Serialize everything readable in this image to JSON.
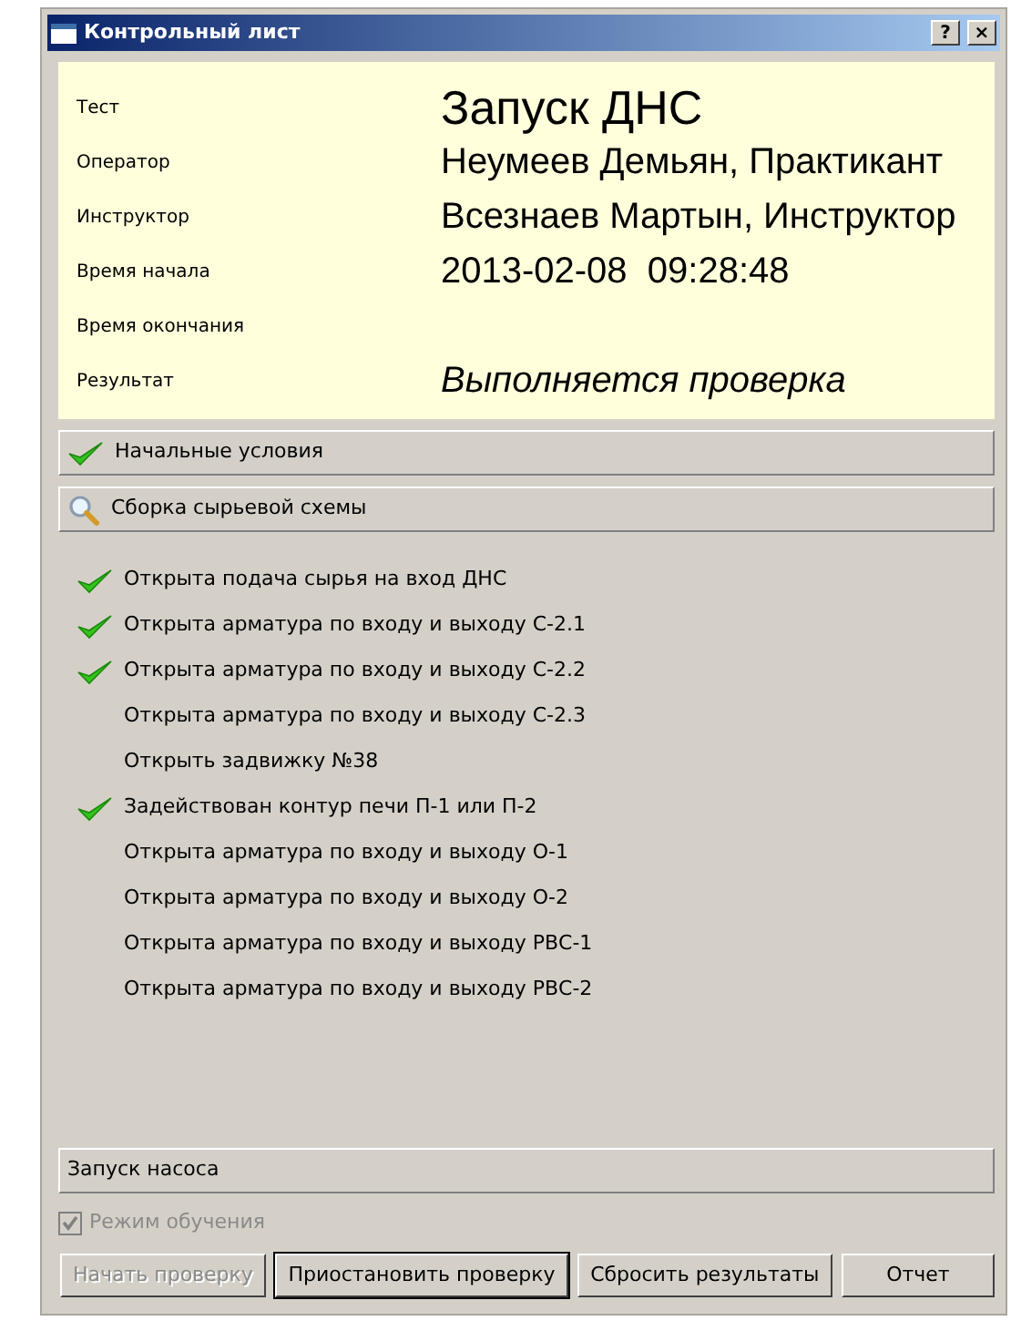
{
  "window": {
    "title": "Контрольный лист",
    "help_button": "?",
    "close_button": "×"
  },
  "info": [
    {
      "label": "Тест",
      "value": "Запуск ДНС",
      "kind": "large"
    },
    {
      "label": "Оператор",
      "value": "Неумеев Демьян, Практикант",
      "kind": "bold"
    },
    {
      "label": "Инструктор",
      "value": "Всезнаев Мартын, Инструктор",
      "kind": "bold"
    },
    {
      "label": "Время начала",
      "value": "2013-02-08  09:28:48",
      "kind": "bold"
    },
    {
      "label": "Время окончания"
    },
    {
      "label": "Результат",
      "value": "Выполняется проверка",
      "kind": "italic"
    }
  ],
  "sections": [
    {
      "title": "Начальные условия",
      "kind": "done"
    },
    {
      "title": "Сборка сырьевой схемы",
      "kind": "active",
      "items": [
        {
          "text": "Открыта подача сырья на вход ДНС",
          "done": true
        },
        {
          "text": "Открыта арматура по входу и выходу С-2.1",
          "done": true
        },
        {
          "text": "Открыта арматура по входу и выходу С-2.2",
          "done": true
        },
        {
          "text": "Открыта арматура по входу и выходу С-2.3",
          "done": false
        },
        {
          "text": "Открыть задвижку №38",
          "done": false
        },
        {
          "text": "Задействован контур печи П-1 или П-2",
          "done": true
        },
        {
          "text": "Открыта арматура по входу и выходу О-1",
          "done": false
        },
        {
          "text": "Открыта арматура по входу и выходу О-2",
          "done": false
        },
        {
          "text": "Открыта арматура по входу и выходу РВС-1",
          "done": false
        },
        {
          "text": "Открыта арматура по входу и выходу РВС-2",
          "done": false
        }
      ]
    },
    {
      "title": "Запуск насоса",
      "kind": "pending"
    }
  ],
  "training_mode": {
    "label": "Режим обучения",
    "checked": true,
    "disabled": true
  },
  "buttons": [
    {
      "label": "Начать проверку",
      "disabled": true,
      "default": false
    },
    {
      "label": "Приостановить проверку",
      "disabled": false,
      "default": true
    },
    {
      "label": "Сбросить результаты",
      "disabled": false,
      "default": false
    },
    {
      "label": "Отчет",
      "disabled": false,
      "default": false
    }
  ]
}
